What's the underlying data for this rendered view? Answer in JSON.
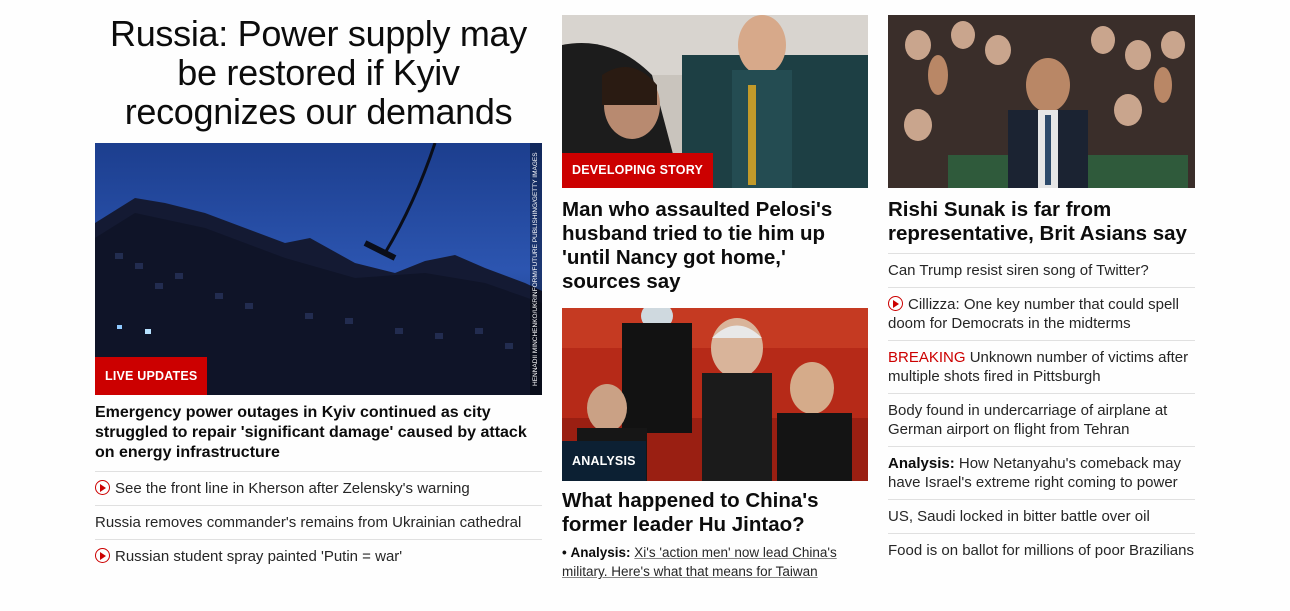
{
  "col1": {
    "headline": "Russia: Power supply may be restored if Kyiv recognizes our demands",
    "image_tag": "LIVE UPDATES",
    "image_credit": "HENNADII MINCHENKO/UKRINFORM/FUTURE PUBLISHING/GETTY IMAGES",
    "lead": "Emergency power outages in Kyiv continued as city struggled to repair 'significant damage' caused by attack on energy infrastructure",
    "links": [
      {
        "text": "See the front line in Kherson after Zelensky's warning",
        "icon": "play-icon"
      },
      {
        "text": "Russia removes commander's remains from Ukrainian cathedral",
        "icon": ""
      },
      {
        "text": "Russian student spray painted 'Putin = war'",
        "icon": "play-icon"
      }
    ]
  },
  "col2": {
    "story1": {
      "tag": "DEVELOPING STORY",
      "headline": "Man who assaulted Pelosi's husband tried to tie him up 'until Nancy got home,' sources say"
    },
    "story2": {
      "tag": "ANALYSIS",
      "headline": "What happened to China's former leader Hu Jintao?",
      "bullet": "•",
      "analysis_label": "Analysis:",
      "analysis_text": "Xi's 'action men' now lead China's military. Here's what that means for Taiwan"
    }
  },
  "col3": {
    "headline": "Rishi Sunak is far from representative, Brit Asians say",
    "links": [
      {
        "prefix": "",
        "prefix_style": "",
        "text": "Can Trump resist siren song of Twitter?",
        "icon": ""
      },
      {
        "prefix": "",
        "prefix_style": "",
        "text": "Cillizza: One key number that could spell doom for Democrats in the midterms",
        "icon": "play-icon"
      },
      {
        "prefix": "BREAKING",
        "prefix_style": "breaking",
        "text": " Unknown number of victims after multiple shots fired in Pittsburgh",
        "icon": ""
      },
      {
        "prefix": "",
        "prefix_style": "",
        "text": "Body found in undercarriage of airplane at German airport on flight from Tehran",
        "icon": ""
      },
      {
        "prefix": "Analysis:",
        "prefix_style": "bold",
        "text": " How Netanyahu's comeback may have Israel's extreme right coming to power",
        "icon": ""
      },
      {
        "prefix": "",
        "prefix_style": "",
        "text": "US, Saudi locked in bitter battle over oil",
        "icon": ""
      },
      {
        "prefix": "",
        "prefix_style": "",
        "text": "Food is on ballot for millions of poor Brazilians",
        "icon": ""
      }
    ]
  },
  "colors": {
    "accent": "#cc0000",
    "dark_tag": "#0c2033"
  }
}
